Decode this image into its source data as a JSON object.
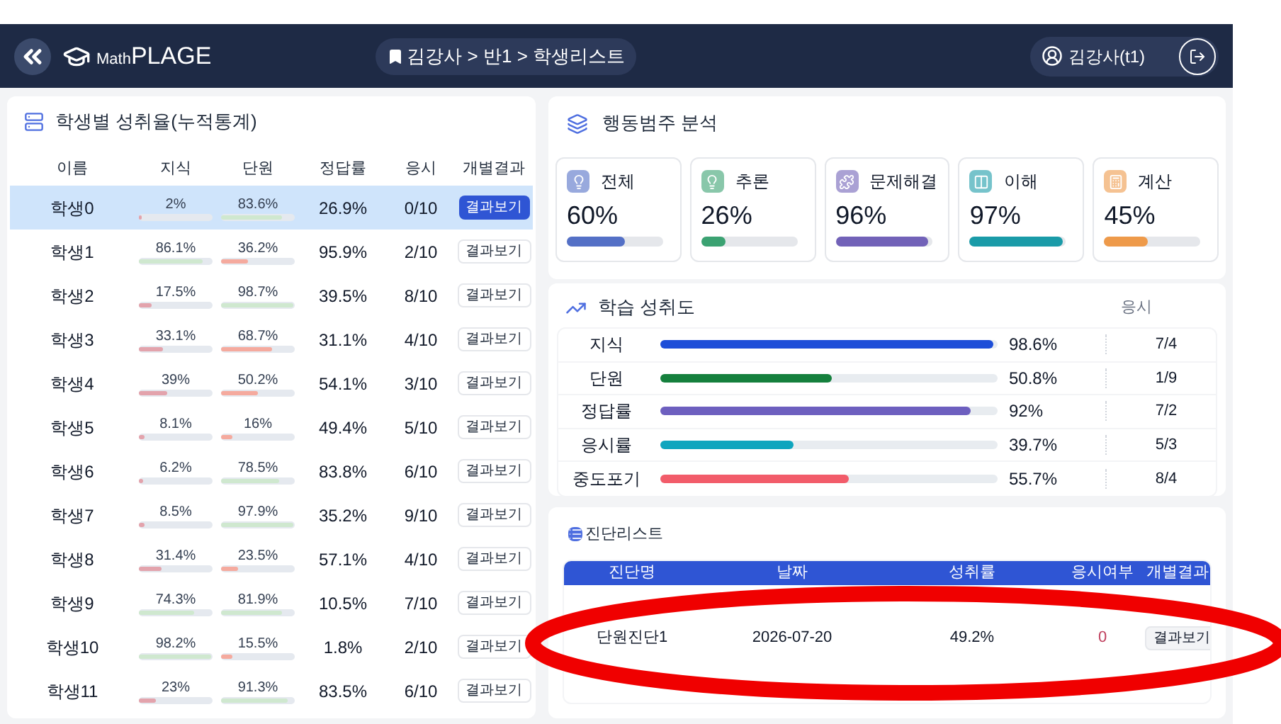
{
  "header": {
    "logo_small": "Math",
    "logo_large": "PLAGE",
    "breadcrumb": "김강사 > 반1 > 학생리스트",
    "user": "김강사(t1)"
  },
  "students_panel": {
    "title": "학생별 성취율(누적통계)",
    "columns": [
      "이름",
      "지식",
      "단원",
      "정답률",
      "응시",
      "개별결과"
    ],
    "rows": [
      {
        "name": "학생0",
        "knowledge": {
          "text": "2%",
          "level": 0.02
        },
        "unit": {
          "text": "83.6%",
          "level": 0.836
        },
        "rate": "26.9%",
        "attempts": "0/10",
        "button": "결과보기",
        "selected": true
      },
      {
        "name": "학생1",
        "knowledge": {
          "text": "86.1%",
          "level": 0.861
        },
        "unit": {
          "text": "36.2%",
          "level": 0.362
        },
        "rate": "95.9%",
        "attempts": "2/10",
        "button": "결과보기",
        "selected": false
      },
      {
        "name": "학생2",
        "knowledge": {
          "text": "17.5%",
          "level": 0.175
        },
        "unit": {
          "text": "98.7%",
          "level": 0.987
        },
        "rate": "39.5%",
        "attempts": "8/10",
        "button": "결과보기",
        "selected": false
      },
      {
        "name": "학생3",
        "knowledge": {
          "text": "33.1%",
          "level": 0.331
        },
        "unit": {
          "text": "68.7%",
          "level": 0.687
        },
        "rate": "31.1%",
        "attempts": "4/10",
        "button": "결과보기",
        "selected": false
      },
      {
        "name": "학생4",
        "knowledge": {
          "text": "39%",
          "level": 0.39
        },
        "unit": {
          "text": "50.2%",
          "level": 0.502
        },
        "rate": "54.1%",
        "attempts": "3/10",
        "button": "결과보기",
        "selected": false
      },
      {
        "name": "학생5",
        "knowledge": {
          "text": "8.1%",
          "level": 0.081
        },
        "unit": {
          "text": "16%",
          "level": 0.16
        },
        "rate": "49.4%",
        "attempts": "5/10",
        "button": "결과보기",
        "selected": false
      },
      {
        "name": "학생6",
        "knowledge": {
          "text": "6.2%",
          "level": 0.062
        },
        "unit": {
          "text": "78.5%",
          "level": 0.785
        },
        "rate": "83.8%",
        "attempts": "6/10",
        "button": "결과보기",
        "selected": false
      },
      {
        "name": "학생7",
        "knowledge": {
          "text": "8.5%",
          "level": 0.085
        },
        "unit": {
          "text": "97.9%",
          "level": 0.979
        },
        "rate": "35.2%",
        "attempts": "9/10",
        "button": "결과보기",
        "selected": false
      },
      {
        "name": "학생8",
        "knowledge": {
          "text": "31.4%",
          "level": 0.314
        },
        "unit": {
          "text": "23.5%",
          "level": 0.235
        },
        "rate": "57.1%",
        "attempts": "4/10",
        "button": "결과보기",
        "selected": false
      },
      {
        "name": "학생9",
        "knowledge": {
          "text": "74.3%",
          "level": 0.743
        },
        "unit": {
          "text": "81.9%",
          "level": 0.819
        },
        "rate": "10.5%",
        "attempts": "7/10",
        "button": "결과보기",
        "selected": false
      },
      {
        "name": "학생10",
        "knowledge": {
          "text": "98.2%",
          "level": 0.982
        },
        "unit": {
          "text": "15.5%",
          "level": 0.155
        },
        "rate": "1.8%",
        "attempts": "2/10",
        "button": "결과보기",
        "selected": false
      },
      {
        "name": "학생11",
        "knowledge": {
          "text": "23%",
          "level": 0.23
        },
        "unit": {
          "text": "91.3%",
          "level": 0.913
        },
        "rate": "83.5%",
        "attempts": "6/10",
        "button": "결과보기",
        "selected": false
      }
    ]
  },
  "behavior_panel": {
    "title": "행동범주 분석",
    "cards": [
      {
        "label": "전체",
        "value": "60%",
        "level": 0.6,
        "color": "#5470c6"
      },
      {
        "label": "추론",
        "value": "26%",
        "level": 0.26,
        "color": "#3ba272"
      },
      {
        "label": "문제해결",
        "value": "96%",
        "level": 0.96,
        "color": "#7262b8"
      },
      {
        "label": "이해",
        "value": "97%",
        "level": 0.97,
        "color": "#1a9ba8"
      },
      {
        "label": "계산",
        "value": "45%",
        "level": 0.45,
        "color": "#ee9a4a"
      }
    ]
  },
  "achievement_panel": {
    "title": "학습 성취도",
    "attempts_heading": "응시",
    "rows": [
      {
        "label": "지식",
        "level": 0.986,
        "value": "98.6%",
        "attempts": "7/4",
        "color": "#1d4ed8"
      },
      {
        "label": "단원",
        "level": 0.508,
        "value": "50.8%",
        "attempts": "1/9",
        "color": "#15803d"
      },
      {
        "label": "정답률",
        "level": 0.92,
        "value": "92%",
        "attempts": "7/2",
        "color": "#6d5fbf"
      },
      {
        "label": "응시률",
        "level": 0.397,
        "value": "39.7%",
        "attempts": "5/3",
        "color": "#0ea5be"
      },
      {
        "label": "중도포기",
        "level": 0.557,
        "value": "55.7%",
        "attempts": "8/4",
        "color": "#f25c6a"
      }
    ]
  },
  "diagnosis_panel": {
    "title": "진단리스트",
    "columns": [
      "진단명",
      "날짜",
      "성취률",
      "응시여부",
      "개별결과"
    ],
    "rows": [
      {
        "name": "단원진단1",
        "date": "2026-07-20",
        "rate": "49.2%",
        "taken": "0",
        "button": "결과보기"
      }
    ]
  },
  "annotation": {
    "kind": "ellipse"
  }
}
